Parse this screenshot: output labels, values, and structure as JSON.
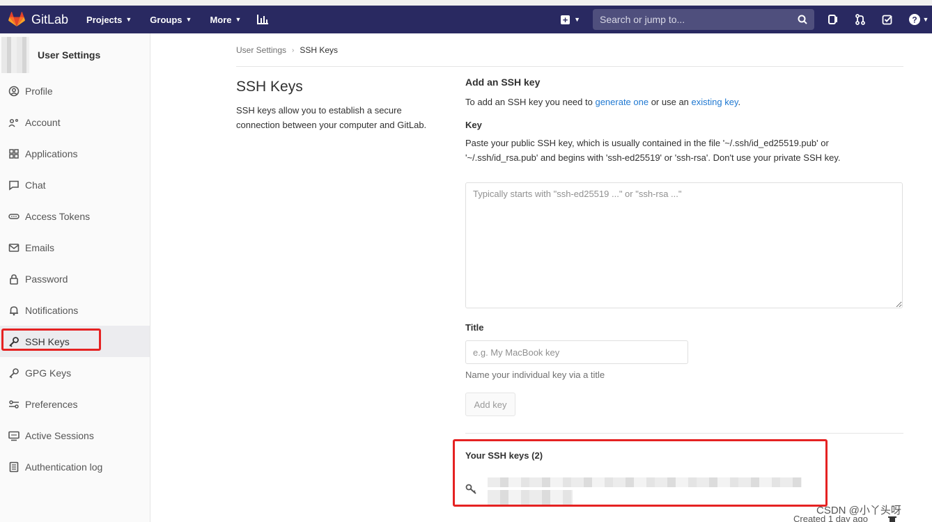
{
  "app": {
    "name": "GitLab"
  },
  "navbar": {
    "projects": "Projects",
    "groups": "Groups",
    "more": "More",
    "search_placeholder": "Search or jump to..."
  },
  "sidebar": {
    "header": "User Settings",
    "items": [
      {
        "label": "Profile",
        "icon": "profile-icon"
      },
      {
        "label": "Account",
        "icon": "account-icon"
      },
      {
        "label": "Applications",
        "icon": "applications-icon"
      },
      {
        "label": "Chat",
        "icon": "chat-icon"
      },
      {
        "label": "Access Tokens",
        "icon": "token-icon"
      },
      {
        "label": "Emails",
        "icon": "email-icon"
      },
      {
        "label": "Password",
        "icon": "lock-icon"
      },
      {
        "label": "Notifications",
        "icon": "bell-icon"
      },
      {
        "label": "SSH Keys",
        "icon": "key-icon",
        "active": true
      },
      {
        "label": "GPG Keys",
        "icon": "key-icon"
      },
      {
        "label": "Preferences",
        "icon": "preferences-icon"
      },
      {
        "label": "Active Sessions",
        "icon": "monitor-icon"
      },
      {
        "label": "Authentication log",
        "icon": "log-icon"
      }
    ]
  },
  "breadcrumb": {
    "parent": "User Settings",
    "current": "SSH Keys"
  },
  "page": {
    "title": "SSH Keys",
    "description": "SSH keys allow you to establish a secure connection between your computer and GitLab."
  },
  "form": {
    "add_heading": "Add an SSH key",
    "add_text_before": "To add an SSH key you need to ",
    "generate_link": "generate one",
    "add_text_middle": " or use an ",
    "existing_link": "existing key",
    "add_text_after": ".",
    "key_label": "Key",
    "key_help": "Paste your public SSH key, which is usually contained in the file '~/.ssh/id_ed25519.pub' or '~/.ssh/id_rsa.pub' and begins with 'ssh-ed25519' or 'ssh-rsa'. Don't use your private SSH key.",
    "key_placeholder": "Typically starts with \"ssh-ed25519 ...\" or \"ssh-rsa ...\"",
    "title_label": "Title",
    "title_placeholder": "e.g. My MacBook key",
    "title_help": "Name your individual key via a title",
    "add_button": "Add key"
  },
  "keys": {
    "heading": "Your SSH keys (2)",
    "created": "Created 1 day ago"
  },
  "watermark": "CSDN @小丫头呀",
  "colors": {
    "navbar": "#292961",
    "link": "#1f78d1",
    "highlight": "#e52222"
  }
}
